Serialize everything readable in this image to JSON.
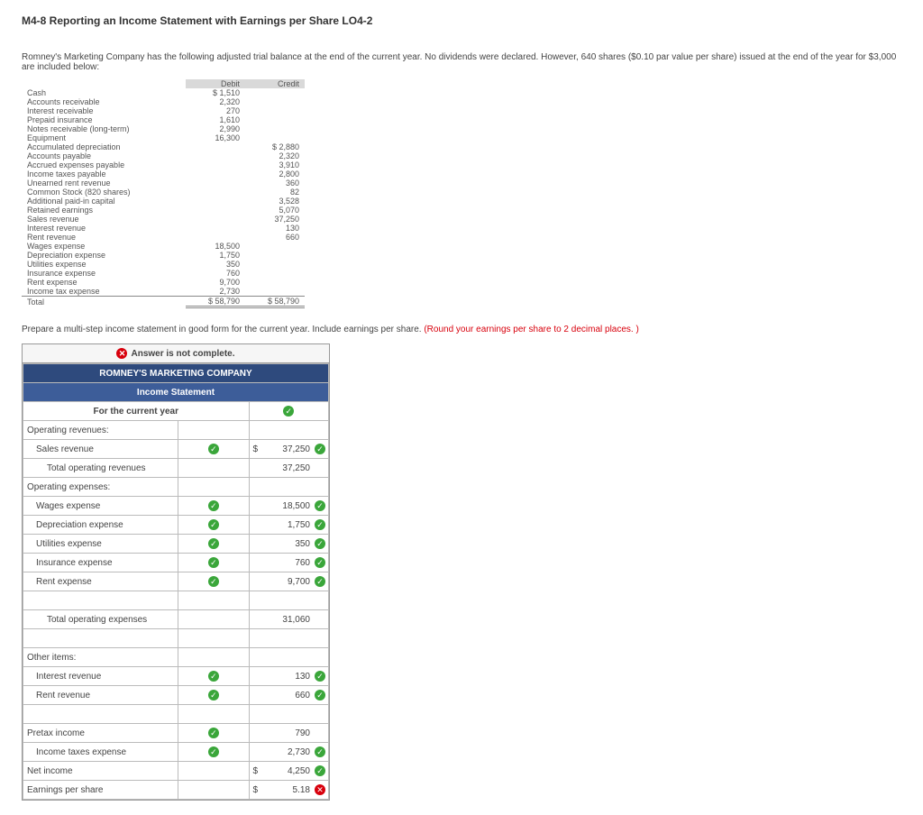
{
  "page": {
    "title": "M4-8 Reporting an Income Statement with Earnings per Share LO4-2",
    "intro": "Romney's Marketing Company has the following adjusted trial balance at the end of the current year. No dividends were declared. However, 640 shares ($0.10 par value per share) issued at the end of the year for $3,000 are included below:",
    "instruction": "Prepare a multi-step income statement in good form for the current year. Include earnings per share. ",
    "instruction_red": "(Round your earnings per share to 2 decimal places. )"
  },
  "tb": {
    "head_debit": "Debit",
    "head_credit": "Credit",
    "rows": [
      {
        "label": "Cash",
        "debit": "$   1,510",
        "credit": ""
      },
      {
        "label": "Accounts receivable",
        "debit": "2,320",
        "credit": ""
      },
      {
        "label": "Interest receivable",
        "debit": "270",
        "credit": ""
      },
      {
        "label": "Prepaid insurance",
        "debit": "1,610",
        "credit": ""
      },
      {
        "label": "Notes receivable (long-term)",
        "debit": "2,990",
        "credit": ""
      },
      {
        "label": "Equipment",
        "debit": "16,300",
        "credit": ""
      },
      {
        "label": "Accumulated depreciation",
        "debit": "",
        "credit": "$   2,880"
      },
      {
        "label": "Accounts payable",
        "debit": "",
        "credit": "2,320"
      },
      {
        "label": "Accrued expenses payable",
        "debit": "",
        "credit": "3,910"
      },
      {
        "label": "Income taxes payable",
        "debit": "",
        "credit": "2,800"
      },
      {
        "label": "Unearned rent revenue",
        "debit": "",
        "credit": "360"
      },
      {
        "label": "Common Stock (820 shares)",
        "debit": "",
        "credit": "82"
      },
      {
        "label": "Additional paid-in capital",
        "debit": "",
        "credit": "3,528"
      },
      {
        "label": "Retained earnings",
        "debit": "",
        "credit": "5,070"
      },
      {
        "label": "Sales revenue",
        "debit": "",
        "credit": "37,250"
      },
      {
        "label": "Interest revenue",
        "debit": "",
        "credit": "130"
      },
      {
        "label": "Rent revenue",
        "debit": "",
        "credit": "660"
      },
      {
        "label": "Wages expense",
        "debit": "18,500",
        "credit": ""
      },
      {
        "label": "Depreciation expense",
        "debit": "1,750",
        "credit": ""
      },
      {
        "label": "Utilities expense",
        "debit": "350",
        "credit": ""
      },
      {
        "label": "Insurance expense",
        "debit": "760",
        "credit": ""
      },
      {
        "label": "Rent expense",
        "debit": "9,700",
        "credit": ""
      },
      {
        "label": "Income tax expense",
        "debit": "2,730",
        "credit": ""
      }
    ],
    "total_label": "Total",
    "total_debit": "$  58,790",
    "total_credit": "$  58,790"
  },
  "answer": {
    "not_complete": "Answer is not complete.",
    "company": "ROMNEY'S MARKETING COMPANY",
    "stmt": "Income Statement",
    "period": "For the current year",
    "rows": {
      "op_rev_hdr": "Operating revenues:",
      "sales_rev": "Sales revenue",
      "sales_rev_amt": "37,250",
      "tot_op_rev": "Total operating revenues",
      "tot_op_rev_amt": "37,250",
      "op_exp_hdr": "Operating expenses:",
      "wages": "Wages expense",
      "wages_amt": "18,500",
      "dep": "Depreciation expense",
      "dep_amt": "1,750",
      "util": "Utilities expense",
      "util_amt": "350",
      "ins": "Insurance expense",
      "ins_amt": "760",
      "rent": "Rent expense",
      "rent_amt": "9,700",
      "tot_op_exp": "Total operating expenses",
      "tot_op_exp_amt": "31,060",
      "other_hdr": "Other items:",
      "int_rev": "Interest revenue",
      "int_rev_amt": "130",
      "rent_rev": "Rent revenue",
      "rent_rev_amt": "660",
      "pretax": "Pretax income",
      "pretax_amt": "790",
      "tax": "Income taxes expense",
      "tax_amt": "2,730",
      "net": "Net income",
      "net_amt": "4,250",
      "eps": "Earnings per share",
      "eps_amt": "5.18"
    }
  }
}
